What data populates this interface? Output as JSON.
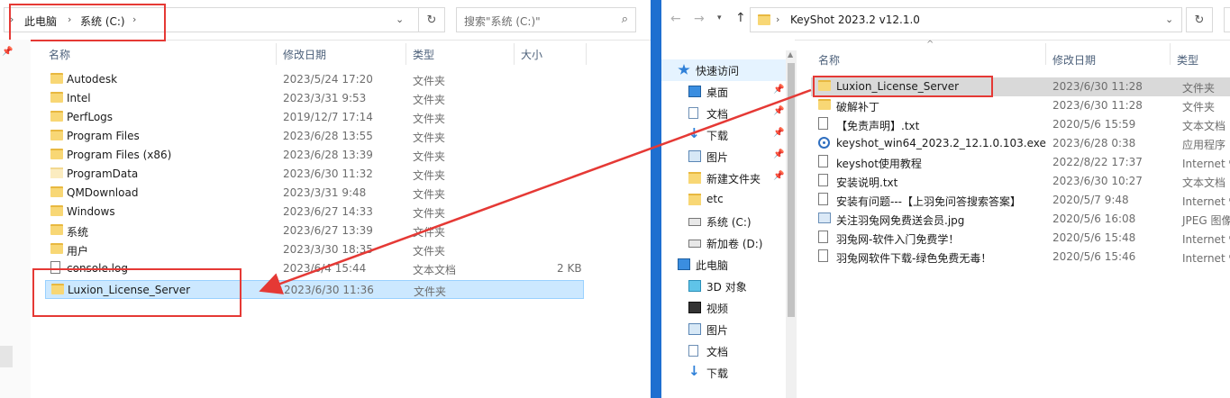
{
  "left": {
    "breadcrumb": [
      "此电脑",
      "系统 (C:)"
    ],
    "search_placeholder": "搜索\"系统 (C:)\"",
    "columns": [
      "名称",
      "修改日期",
      "类型",
      "大小"
    ],
    "files": [
      {
        "name": "Autodesk",
        "date": "2023/5/24 17:20",
        "type": "文件夹",
        "size": "",
        "icon": "folder-icon"
      },
      {
        "name": "Intel",
        "date": "2023/3/31 9:53",
        "type": "文件夹",
        "size": "",
        "icon": "folder-icon"
      },
      {
        "name": "PerfLogs",
        "date": "2019/12/7 17:14",
        "type": "文件夹",
        "size": "",
        "icon": "folder-icon"
      },
      {
        "name": "Program Files",
        "date": "2023/6/28 13:55",
        "type": "文件夹",
        "size": "",
        "icon": "folder-icon"
      },
      {
        "name": "Program Files (x86)",
        "date": "2023/6/28 13:39",
        "type": "文件夹",
        "size": "",
        "icon": "folder-icon"
      },
      {
        "name": "ProgramData",
        "date": "2023/6/30 11:32",
        "type": "文件夹",
        "size": "",
        "icon": "folder-hidden-icon"
      },
      {
        "name": "QMDownload",
        "date": "2023/3/31 9:48",
        "type": "文件夹",
        "size": "",
        "icon": "folder-icon"
      },
      {
        "name": "Windows",
        "date": "2023/6/27 14:33",
        "type": "文件夹",
        "size": "",
        "icon": "folder-icon"
      },
      {
        "name": "系统",
        "date": "2023/6/27 13:39",
        "type": "文件夹",
        "size": "",
        "icon": "folder-icon"
      },
      {
        "name": "用户",
        "date": "2023/3/30 18:35",
        "type": "文件夹",
        "size": "",
        "icon": "folder-icon"
      },
      {
        "name": "console.log",
        "date": "2023/6/4 15:44",
        "type": "文本文档",
        "size": "2 KB",
        "icon": "text-file-icon"
      },
      {
        "name": "Luxion_License_Server",
        "date": "2023/6/30 11:36",
        "type": "文件夹",
        "size": "",
        "icon": "folder-icon"
      }
    ]
  },
  "right": {
    "breadcrumb": "KeyShot 2023.2 v12.1.0",
    "columns": [
      "名称",
      "修改日期",
      "类型"
    ],
    "nav": [
      {
        "label": "快速访问",
        "icon": "star-icon",
        "pinned": false,
        "level": 0
      },
      {
        "label": "桌面",
        "icon": "desktop-icon",
        "pinned": true,
        "level": 1
      },
      {
        "label": "文档",
        "icon": "documents-icon",
        "pinned": true,
        "level": 1
      },
      {
        "label": "下载",
        "icon": "download-icon",
        "pinned": true,
        "level": 1
      },
      {
        "label": "图片",
        "icon": "pictures-icon",
        "pinned": true,
        "level": 1
      },
      {
        "label": "新建文件夹",
        "icon": "folder-icon",
        "pinned": true,
        "level": 1
      },
      {
        "label": "etc",
        "icon": "folder-icon",
        "pinned": false,
        "level": 1
      },
      {
        "label": "系统 (C:)",
        "icon": "drive-icon",
        "pinned": false,
        "level": 1
      },
      {
        "label": "新加卷 (D:)",
        "icon": "drive-icon",
        "pinned": false,
        "level": 1
      },
      {
        "label": "此电脑",
        "icon": "computer-icon",
        "pinned": false,
        "level": 0
      },
      {
        "label": "3D 对象",
        "icon": "3d-objects-icon",
        "pinned": false,
        "level": 1
      },
      {
        "label": "视频",
        "icon": "videos-icon",
        "pinned": false,
        "level": 1
      },
      {
        "label": "图片",
        "icon": "pictures-icon",
        "pinned": false,
        "level": 1
      },
      {
        "label": "文档",
        "icon": "documents-icon",
        "pinned": false,
        "level": 1
      },
      {
        "label": "下载",
        "icon": "download-icon",
        "pinned": false,
        "level": 1
      }
    ],
    "files": [
      {
        "name": "Luxion_License_Server",
        "date": "2023/6/30 11:28",
        "type": "文件夹",
        "icon": "folder-icon"
      },
      {
        "name": "破解补丁",
        "date": "2023/6/30 11:28",
        "type": "文件夹",
        "icon": "folder-icon"
      },
      {
        "name": "【免责声明】.txt",
        "date": "2020/5/6 15:59",
        "type": "文本文档",
        "icon": "text-file-icon"
      },
      {
        "name": "keyshot_win64_2023.2_12.1.0.103.exe",
        "date": "2023/6/28 0:38",
        "type": "应用程序",
        "icon": "installer-icon"
      },
      {
        "name": "keyshot使用教程",
        "date": "2022/8/22 17:37",
        "type": "Internet 快",
        "icon": "shortcut-icon"
      },
      {
        "name": "安装说明.txt",
        "date": "2023/6/30 10:27",
        "type": "文本文档",
        "icon": "text-file-icon"
      },
      {
        "name": "安装有问题---【上羽免问答搜索答案】",
        "date": "2020/5/7 9:48",
        "type": "Internet 快",
        "icon": "shortcut-icon"
      },
      {
        "name": "关注羽兔网免费送会员.jpg",
        "date": "2020/5/6 16:08",
        "type": "JPEG 图像",
        "icon": "image-icon"
      },
      {
        "name": "羽兔网-软件入门免费学！",
        "date": "2020/5/6 15:48",
        "type": "Internet 快",
        "icon": "shortcut-icon"
      },
      {
        "name": "羽兔网软件下载-绿色免费无毒！",
        "date": "2020/5/6 15:46",
        "type": "Internet 快",
        "icon": "shortcut-icon"
      }
    ]
  },
  "colors": {
    "annotation": "#e53935",
    "selection": "#cce8ff"
  }
}
